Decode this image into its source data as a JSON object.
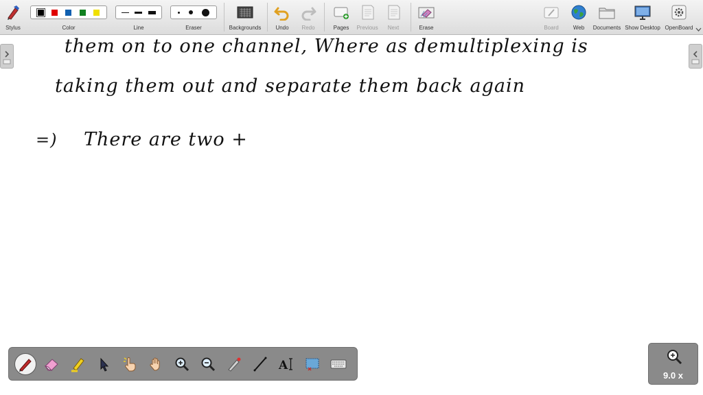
{
  "toolbar": {
    "stylus_label": "Stylus",
    "color_label": "Color",
    "line_label": "Line",
    "eraser_label": "Eraser",
    "backgrounds_label": "Backgrounds",
    "undo_label": "Undo",
    "redo_label": "Redo",
    "pages_label": "Pages",
    "previous_label": "Previous",
    "next_label": "Next",
    "erase_label": "Erase",
    "board_label": "Board",
    "web_label": "Web",
    "documents_label": "Documents",
    "show_desktop_label": "Show Desktop",
    "openboard_label": "OpenBoard",
    "colors": [
      "#000000",
      "#e00000",
      "#1060b0",
      "#108020",
      "#f0e000"
    ],
    "selected_color": "#000000"
  },
  "canvas": {
    "line1": "them  on to  one  channel,  Where as  demultiplexing  is",
    "line2": "taking  them  out  and  separate  them  back  again",
    "line3_arrow": "=)",
    "line3": "There   are   two   +"
  },
  "stylus_palette": {
    "tools": [
      "pen",
      "eraser",
      "highlighter",
      "selector",
      "interact",
      "hand",
      "zoom-in",
      "zoom-out",
      "laser",
      "line",
      "text",
      "capture",
      "keyboard"
    ],
    "active_tool": "pen"
  },
  "zoom": {
    "level": "9.0 x"
  }
}
